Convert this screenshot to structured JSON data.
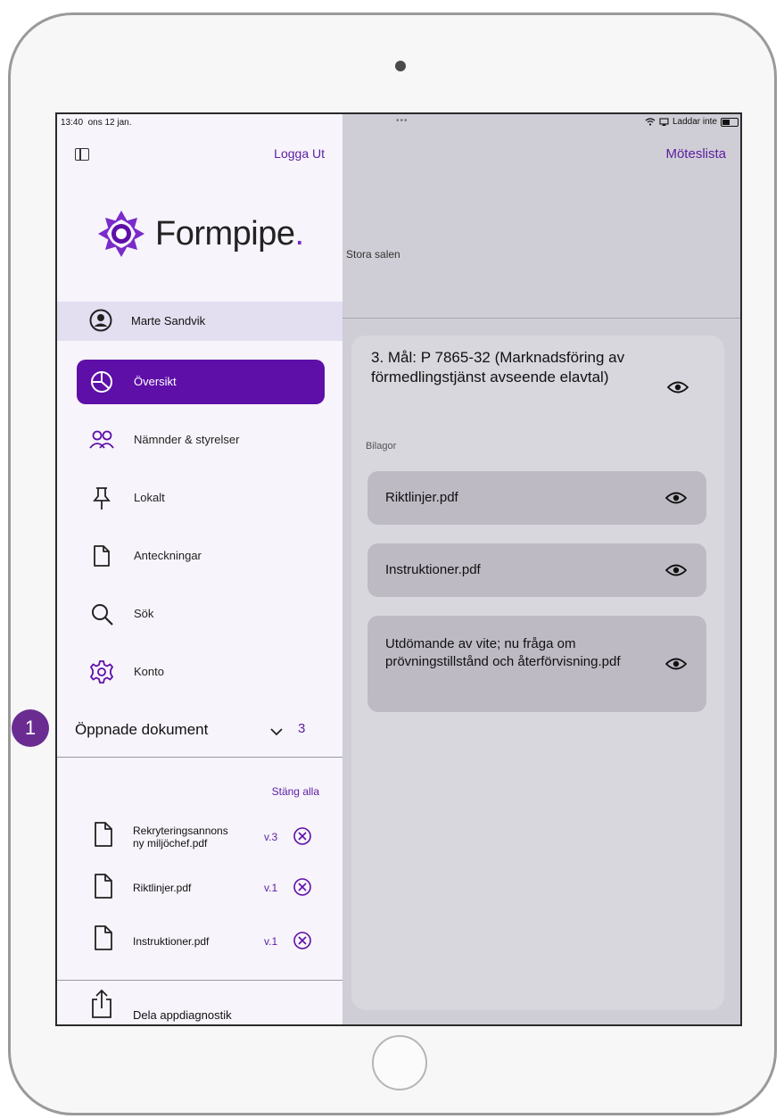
{
  "status_bar": {
    "time": "13:40",
    "date": "ons 12 jan.",
    "dots": "•••",
    "charging": "Laddar inte"
  },
  "header": {
    "logout_label": "Logga Ut",
    "meetings_label": "Möteslista"
  },
  "logo": {
    "word": "Formpipe",
    "dot": "."
  },
  "user": {
    "name": "Marte Sandvik"
  },
  "nav": {
    "items": [
      {
        "label": "Översikt",
        "icon": "overview-icon"
      },
      {
        "label": "Nämnder & styrelser",
        "icon": "people-icon"
      },
      {
        "label": "Lokalt",
        "icon": "pin-icon"
      },
      {
        "label": "Anteckningar",
        "icon": "document-icon"
      },
      {
        "label": "Sök",
        "icon": "search-icon"
      },
      {
        "label": "Konto",
        "icon": "gear-icon"
      }
    ]
  },
  "opened_docs": {
    "title": "Öppnade dokument",
    "count": "3",
    "close_all": "Stäng alla",
    "callout_number": "1",
    "docs": [
      {
        "name_line1": "Rekryteringsannons",
        "name_line2": "ny miljöchef.pdf",
        "version": "v.3"
      },
      {
        "name_line1": "Riktlinjer.pdf",
        "name_line2": "",
        "version": "v.1"
      },
      {
        "name_line1": "Instruktioner.pdf",
        "name_line2": "",
        "version": "v.1"
      }
    ]
  },
  "share": {
    "label": "Dela appdiagnostik"
  },
  "main": {
    "room": "Stora salen",
    "agenda_title": "3. Mål: P 7865-32 (Marknadsföring av förmedlingstjänst avseende elavtal)",
    "attachments_heading": "Bilagor",
    "attachments": [
      {
        "label": "Riktlinjer.pdf"
      },
      {
        "label": "Instruktioner.pdf"
      },
      {
        "label": "Utdömande av vite; nu fråga om prövningstillstånd och återförvisning.pdf"
      }
    ]
  },
  "colors": {
    "accent": "#5e0fa8",
    "callout": "#6a2c91"
  }
}
